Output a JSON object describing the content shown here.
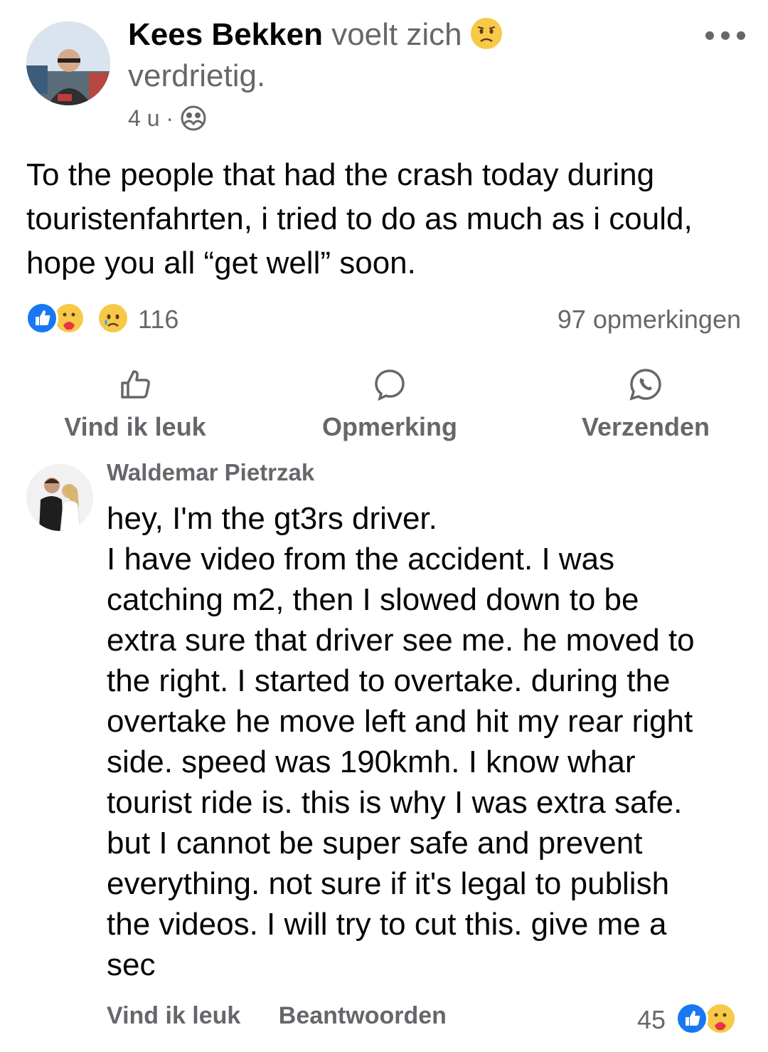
{
  "post": {
    "author": "Kees Bekken",
    "feeling_prefix": "voelt zich",
    "feeling_emoji": "sad-face",
    "feeling_word": "verdrietig.",
    "time": "4 u",
    "separator": "·",
    "audience_icon": "friends-icon",
    "text": "To the people that had the crash today during touristenfahrten, i tried to do as much as i could, hope you all “get well” soon.",
    "reaction_icons": [
      "like",
      "care",
      "sad"
    ],
    "reaction_count": "116",
    "comment_count": "97 opmerkingen"
  },
  "actions": {
    "like_label": "Vind ik leuk",
    "comment_label": "Opmerking",
    "send_label": "Verzenden"
  },
  "comment": {
    "author": "Waldemar Pietrzak",
    "lines": [
      "hey, I'm the gt3rs driver.",
      "I have video from the accident. I was",
      "catching m2, then I slowed down to be",
      "extra sure that driver see me. he moved to",
      "the right. I started to overtake. during the",
      "overtake he move left and hit my rear right",
      "side. speed was 190kmh. I know whar",
      "tourist ride is. this is why I was extra safe.",
      "but I cannot be super safe and prevent",
      "everything. not sure if it's legal to publish",
      "the videos. I will try to cut this. give me a",
      "sec"
    ],
    "like_label": "Vind ik leuk",
    "reply_label": "Beantwoorden",
    "reaction_count": "45",
    "reaction_icons": [
      "like",
      "care"
    ]
  },
  "colors": {
    "secondary_text": "#65676b",
    "like_blue": "#1877f2",
    "emoji_yellow": "#f7c948"
  }
}
